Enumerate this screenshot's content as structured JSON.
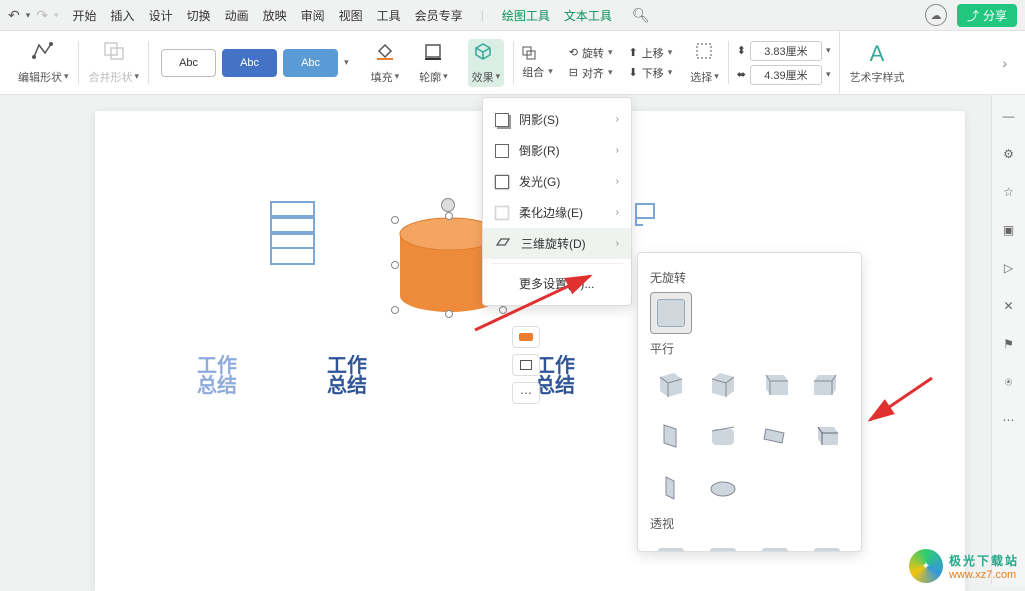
{
  "menu": {
    "tabs": [
      "开始",
      "插入",
      "设计",
      "切换",
      "动画",
      "放映",
      "审阅",
      "视图",
      "工具",
      "会员专享"
    ],
    "drawing_tool": "绘图工具",
    "text_tool": "文本工具"
  },
  "share": "分享",
  "toolbar": {
    "edit_shape": "编辑形状",
    "merge_shape": "合并形状",
    "style_label": "Abc",
    "fill": "填充",
    "outline": "轮廓",
    "effect": "效果",
    "group": "组合",
    "rotate": "旋转",
    "align": "对齐",
    "move_up": "上移",
    "move_down": "下移",
    "select": "选择",
    "width_val": "3.83厘米",
    "height_val": "4.39厘米",
    "art_text": "艺术字样式"
  },
  "menu_popup": {
    "shadow": "阴影(S)",
    "reflection": "倒影(R)",
    "glow": "发光(G)",
    "soft_edge": "柔化边缘(E)",
    "rotate3d": "三维旋转(D)",
    "more": "更多设置(O)..."
  },
  "gallery": {
    "no_rotate": "无旋转",
    "parallel": "平行",
    "perspective": "透视"
  },
  "slide_text": {
    "t1a": "工作",
    "t1b": "总结",
    "t2a": "工作",
    "t2b": "总结",
    "t3a": "工作",
    "t3b": "总结"
  },
  "watermark": {
    "name": "极光下载站",
    "url": "www.xz7.com"
  }
}
